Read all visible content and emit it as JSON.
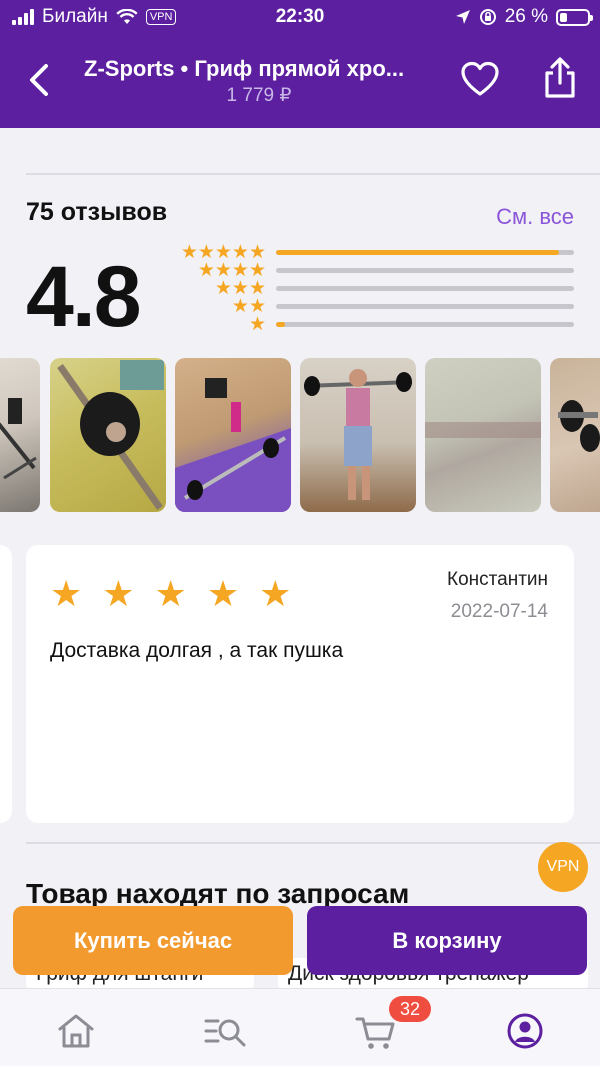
{
  "status_bar": {
    "carrier": "Билайн",
    "vpn": "VPN",
    "time": "22:30",
    "battery": "26 %"
  },
  "header": {
    "title": "Z-Sports • Гриф прямой хро...",
    "price": "1 779 ₽"
  },
  "reviews": {
    "count_label": "75 отзывов",
    "see_all": "См. все",
    "rating": "4.8",
    "distribution": [
      {
        "stars": 5,
        "fraction": 0.95
      },
      {
        "stars": 4,
        "fraction": 0.0
      },
      {
        "stars": 3,
        "fraction": 0.0
      },
      {
        "stars": 2,
        "fraction": 0.0
      },
      {
        "stars": 1,
        "fraction": 0.03
      }
    ]
  },
  "review": {
    "stars": "★ ★ ★ ★ ★",
    "author": "Константин",
    "date": "2022-07-14",
    "text": "Доставка долгая , а так пушка"
  },
  "vpn_button": "VPN",
  "search_section": {
    "title": "Товар находят по запросам",
    "chips": [
      "Гриф для штанги",
      "Диск здоровья тренажер"
    ]
  },
  "actions": {
    "buy_now": "Купить сейчас",
    "add_to_cart": "В корзину"
  },
  "bottom_nav": {
    "cart_count": "32",
    "items": [
      "home-icon",
      "search-icon",
      "cart-icon",
      "profile-icon"
    ]
  },
  "colors": {
    "brand_purple": "#5b1fa0",
    "accent_orange": "#f5a623",
    "link_purple": "#8a55d9",
    "badge_red": "#ef4d3f"
  }
}
